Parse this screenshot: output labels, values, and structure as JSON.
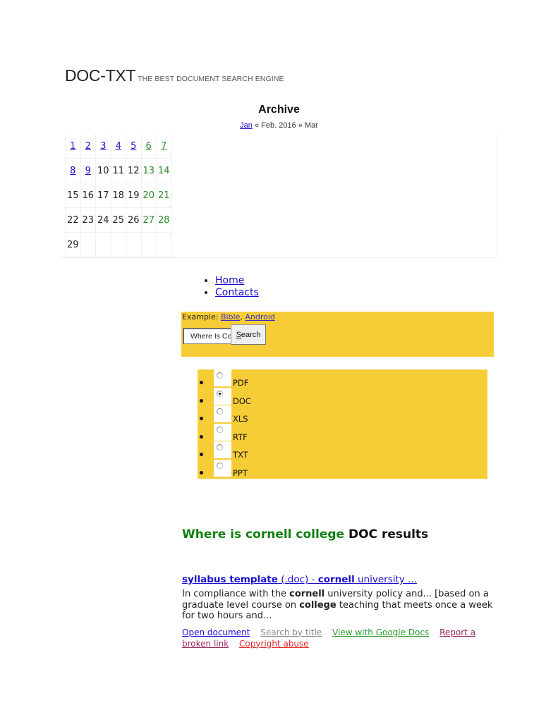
{
  "header": {
    "site_title": "DOC-TXT",
    "tagline": "THE BEST DOCUMENT SEARCH ENGINE"
  },
  "archive": {
    "title": "Archive",
    "prev_month": "Jan",
    "current": " « Feb. 2016 » ",
    "next_month": "Mar",
    "weeks": [
      [
        {
          "day": "1",
          "link": true,
          "weekend": false
        },
        {
          "day": "2",
          "link": true,
          "weekend": false
        },
        {
          "day": "3",
          "link": true,
          "weekend": false
        },
        {
          "day": "4",
          "link": true,
          "weekend": false
        },
        {
          "day": "5",
          "link": true,
          "weekend": false
        },
        {
          "day": "6",
          "link": true,
          "weekend": true
        },
        {
          "day": "7",
          "link": true,
          "weekend": true
        }
      ],
      [
        {
          "day": "8",
          "link": true,
          "weekend": false
        },
        {
          "day": "9",
          "link": true,
          "weekend": false
        },
        {
          "day": "10",
          "link": false,
          "weekend": false
        },
        {
          "day": "11",
          "link": false,
          "weekend": false
        },
        {
          "day": "12",
          "link": false,
          "weekend": false
        },
        {
          "day": "13",
          "link": false,
          "weekend": true
        },
        {
          "day": "14",
          "link": false,
          "weekend": true
        }
      ],
      [
        {
          "day": "15",
          "link": false,
          "weekend": false
        },
        {
          "day": "16",
          "link": false,
          "weekend": false
        },
        {
          "day": "17",
          "link": false,
          "weekend": false
        },
        {
          "day": "18",
          "link": false,
          "weekend": false
        },
        {
          "day": "19",
          "link": false,
          "weekend": false
        },
        {
          "day": "20",
          "link": false,
          "weekend": true
        },
        {
          "day": "21",
          "link": false,
          "weekend": true
        }
      ],
      [
        {
          "day": "22",
          "link": false,
          "weekend": false
        },
        {
          "day": "23",
          "link": false,
          "weekend": false
        },
        {
          "day": "24",
          "link": false,
          "weekend": false
        },
        {
          "day": "25",
          "link": false,
          "weekend": false
        },
        {
          "day": "26",
          "link": false,
          "weekend": false
        },
        {
          "day": "27",
          "link": false,
          "weekend": true
        },
        {
          "day": "28",
          "link": false,
          "weekend": true
        }
      ],
      [
        {
          "day": "29",
          "link": false,
          "weekend": false
        },
        {
          "day": "",
          "link": false,
          "weekend": false
        },
        {
          "day": "",
          "link": false,
          "weekend": false
        },
        {
          "day": "",
          "link": false,
          "weekend": false
        },
        {
          "day": "",
          "link": false,
          "weekend": false
        },
        {
          "day": "",
          "link": false,
          "weekend": false
        },
        {
          "day": "",
          "link": false,
          "weekend": false
        }
      ]
    ]
  },
  "nav": {
    "items": [
      {
        "label": "Home"
      },
      {
        "label": "Contacts"
      }
    ]
  },
  "search": {
    "example_prefix": "Example: ",
    "example_links": [
      "Bible",
      "Android"
    ],
    "example_separator": ", ",
    "input_value": "Where Is Cornell College",
    "button_label_underlined": "S",
    "button_label_rest": "earch",
    "box_color": "#f7cd37"
  },
  "file_types": {
    "options": [
      {
        "label": "PDF",
        "checked": false
      },
      {
        "label": "DOC",
        "checked": true
      },
      {
        "label": "XLS",
        "checked": false
      },
      {
        "label": "RTF",
        "checked": false
      },
      {
        "label": "TXT",
        "checked": false
      },
      {
        "label": "PPT",
        "checked": false
      }
    ]
  },
  "results": {
    "heading_query": "Where is cornell college",
    "heading_suffix": " DOC results",
    "items": [
      {
        "title_bold_1": "syllabus template",
        "title_normal_1": " (.doc) - ",
        "title_bold_2": "cornell",
        "title_normal_2": " university ...",
        "snippet_parts": [
          {
            "text": "In compliance with the ",
            "bold": false
          },
          {
            "text": "cornell",
            "bold": true
          },
          {
            "text": " university policy and... [based on a graduate level course on ",
            "bold": false
          },
          {
            "text": "college",
            "bold": true
          },
          {
            "text": " teaching that meets once a week for two hours and...",
            "bold": false
          }
        ],
        "links": {
          "open": "Open document",
          "search_title": "Search by title",
          "google_docs": "View with Google Docs",
          "report": "Report a broken link",
          "abuse": "Copyright abuse"
        }
      }
    ]
  }
}
